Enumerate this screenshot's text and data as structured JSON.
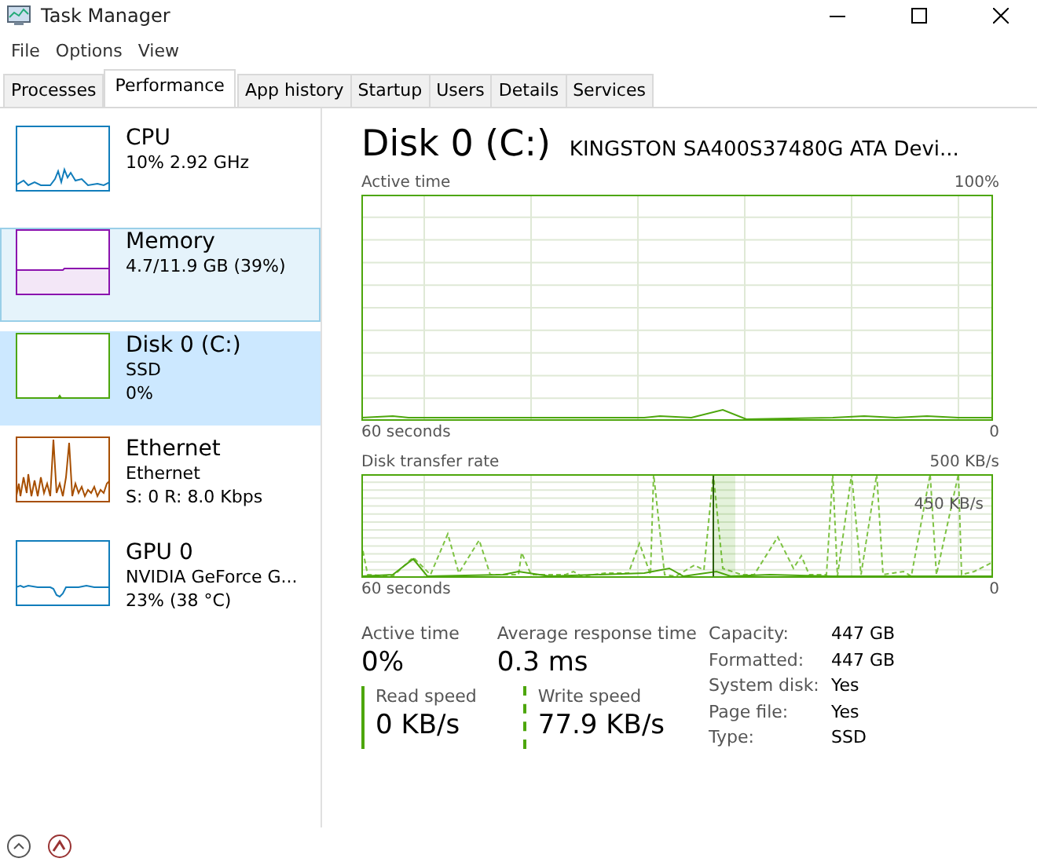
{
  "window": {
    "title": "Task Manager"
  },
  "menu": [
    "File",
    "Options",
    "View"
  ],
  "tabs": [
    {
      "label": "Processes",
      "selected": false
    },
    {
      "label": "Performance",
      "selected": true
    },
    {
      "label": "App history",
      "selected": false
    },
    {
      "label": "Startup",
      "selected": false
    },
    {
      "label": "Users",
      "selected": false
    },
    {
      "label": "Details",
      "selected": false
    },
    {
      "label": "Services",
      "selected": false
    }
  ],
  "sidebar": {
    "items": [
      {
        "kind": "cpu",
        "name": "CPU",
        "lines": [
          "10% 2.92 GHz"
        ],
        "color": "#117dbb",
        "selected": false,
        "hovered": false
      },
      {
        "kind": "memory",
        "name": "Memory",
        "lines": [
          "4.7/11.9 GB (39%)"
        ],
        "color": "#8b12ae",
        "selected": false,
        "hovered": true
      },
      {
        "kind": "disk",
        "name": "Disk 0 (C:)",
        "lines": [
          "SSD",
          "0%"
        ],
        "color": "#4da60c",
        "selected": true,
        "hovered": false
      },
      {
        "kind": "ethernet",
        "name": "Ethernet",
        "lines": [
          "Ethernet",
          "S: 0 R: 8.0 Kbps"
        ],
        "color": "#a74f01",
        "selected": false,
        "hovered": false
      },
      {
        "kind": "gpu",
        "name": "GPU 0",
        "lines": [
          "NVIDIA GeForce G...",
          "23% (38 °C)"
        ],
        "color": "#117dbb",
        "selected": false,
        "hovered": false
      }
    ]
  },
  "detail": {
    "title": "Disk 0 (C:)",
    "model": "KINGSTON SA400S37480G ATA Devi...",
    "graphs": [
      {
        "kind": "activity",
        "label": "Active time",
        "max": "100%",
        "span": "60 seconds",
        "min": "0"
      },
      {
        "kind": "transfer",
        "label": "Disk transfer rate",
        "max": "500 KB/s",
        "span": "60 seconds",
        "min": "0",
        "marker": "450 KB/s"
      }
    ],
    "stats": [
      {
        "label": "Active time",
        "value": "0%"
      },
      {
        "label": "Average response time",
        "value": "0.3 ms"
      }
    ],
    "speeds": [
      {
        "kind": "solid",
        "label": "Read speed",
        "value": "0 KB/s"
      },
      {
        "kind": "dashed",
        "label": "Write speed",
        "value": "77.9 KB/s"
      }
    ],
    "properties": [
      {
        "label": "Capacity:",
        "value": "447 GB"
      },
      {
        "label": "Formatted:",
        "value": "447 GB"
      },
      {
        "label": "System disk:",
        "value": "Yes"
      },
      {
        "label": "Page file:",
        "value": "Yes"
      },
      {
        "label": "Type:",
        "value": "SSD"
      }
    ]
  }
}
